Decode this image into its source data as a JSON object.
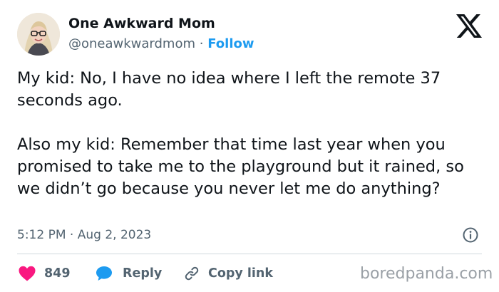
{
  "author": {
    "display_name": "One Awkward Mom",
    "handle": "@oneawkwardmom",
    "separator": "·",
    "follow_label": "Follow"
  },
  "tweet": {
    "paragraph_1": "My kid: No, I have no idea where I left the remote 37 seconds ago.",
    "paragraph_2": "Also my kid: Remember that time last year when you promised to take me to the playground but it rained, so we didn’t go because you never let me do anything?"
  },
  "meta": {
    "time": "5:12 PM",
    "separator": "·",
    "date": "Aug 2, 2023"
  },
  "actions": {
    "like_count": "849",
    "reply_label": "Reply",
    "copy_link_label": "Copy link"
  },
  "watermark": "boredpanda.com",
  "icons": [
    "x-logo-icon",
    "info-icon",
    "heart-icon",
    "reply-bubble-icon",
    "link-icon"
  ],
  "colors": {
    "text": "#0f1419",
    "secondary": "#536471",
    "accent": "#1d9bf0",
    "like": "#f91880",
    "divider": "#cfd9de",
    "watermark": "#9aa0a6"
  }
}
